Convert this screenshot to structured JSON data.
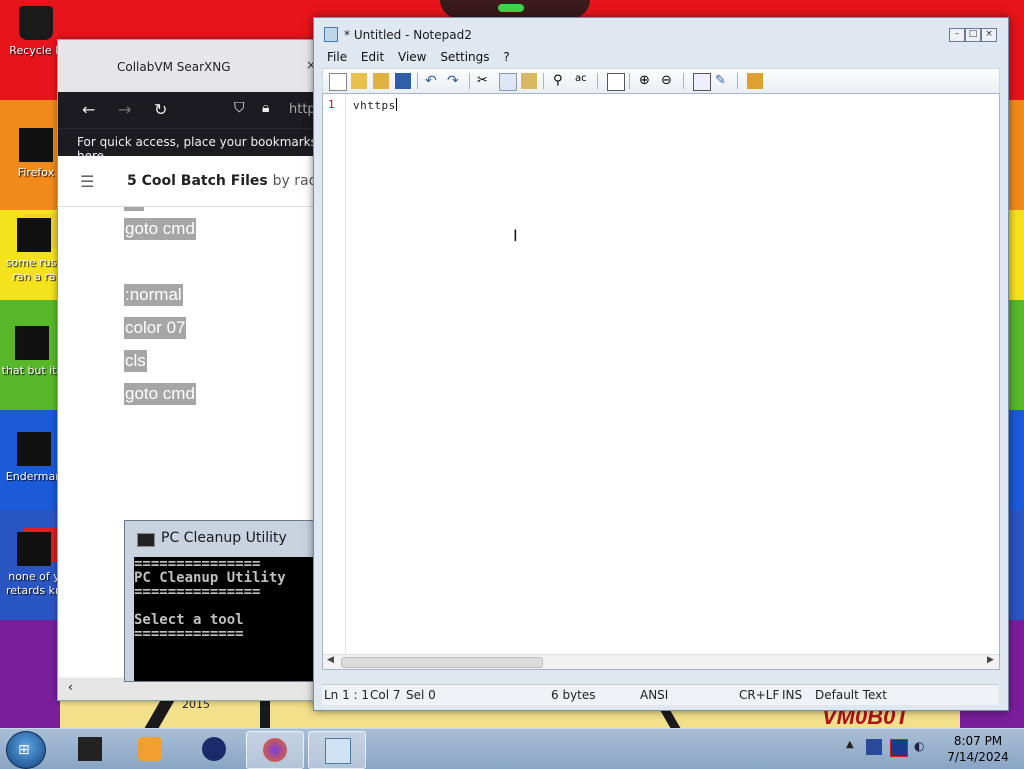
{
  "desktop": {
    "icons": [
      {
        "label": "Recycle B"
      },
      {
        "label": "Firefox"
      },
      {
        "label": "some russ ran a ra"
      },
      {
        "label": "that but its"
      },
      {
        "label": "Enderman"
      },
      {
        "label": "none of y retards kn"
      }
    ],
    "wallpaper_text": "VM0B0T",
    "wallpaper_year": "2015"
  },
  "browser": {
    "tab_title": "CollabVM SearXNG",
    "tab_close": "×",
    "address_partial": "http",
    "bookmarks_hint": "For quick access, place your bookmarks here",
    "page_title": "5 Cool Batch Files",
    "page_byline": "by radam",
    "code_lines": [
      "goto cmd",
      ":normal",
      "color 07",
      "cls",
      "goto cmd"
    ]
  },
  "cmd_window": {
    "title": "PC Cleanup Utility",
    "lines": [
      "===============",
      "PC Cleanup Utility",
      "===============",
      "",
      "Select a tool",
      "============="
    ]
  },
  "notepad": {
    "title": "* Untitled - Notepad2",
    "menu": [
      "File",
      "Edit",
      "View",
      "Settings",
      "?"
    ],
    "line_number": "1",
    "text": "vhttps",
    "status": {
      "position": "Ln 1 : 1",
      "col": "Col 7",
      "sel": "Sel 0",
      "size": "6 bytes",
      "encoding": "ANSI",
      "eol": "CR+LF",
      "mode": "INS",
      "scheme": "Default Text"
    }
  },
  "taskbar": {
    "clock_time": "8:07 PM",
    "clock_date": "7/14/2024"
  }
}
